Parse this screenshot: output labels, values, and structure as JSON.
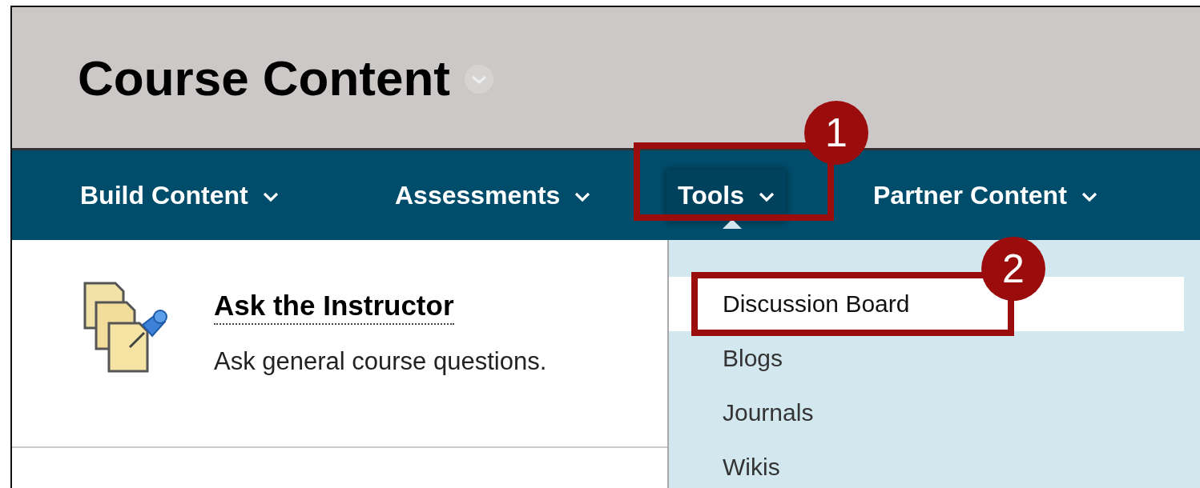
{
  "page_title": "Course Content",
  "nav": [
    {
      "label": "Build Content",
      "expanded": false
    },
    {
      "label": "Assessments",
      "expanded": false
    },
    {
      "label": "Tools",
      "expanded": true,
      "callout": "1"
    },
    {
      "label": "Partner Content",
      "expanded": false
    }
  ],
  "content_items": [
    {
      "title": "Ask the Instructor",
      "description": "Ask general course questions."
    }
  ],
  "dropdown": [
    {
      "label": "Discussion Board",
      "selected": true,
      "callout": "2"
    },
    {
      "label": "Blogs",
      "selected": false
    },
    {
      "label": "Journals",
      "selected": false
    },
    {
      "label": "Wikis",
      "selected": false
    }
  ]
}
